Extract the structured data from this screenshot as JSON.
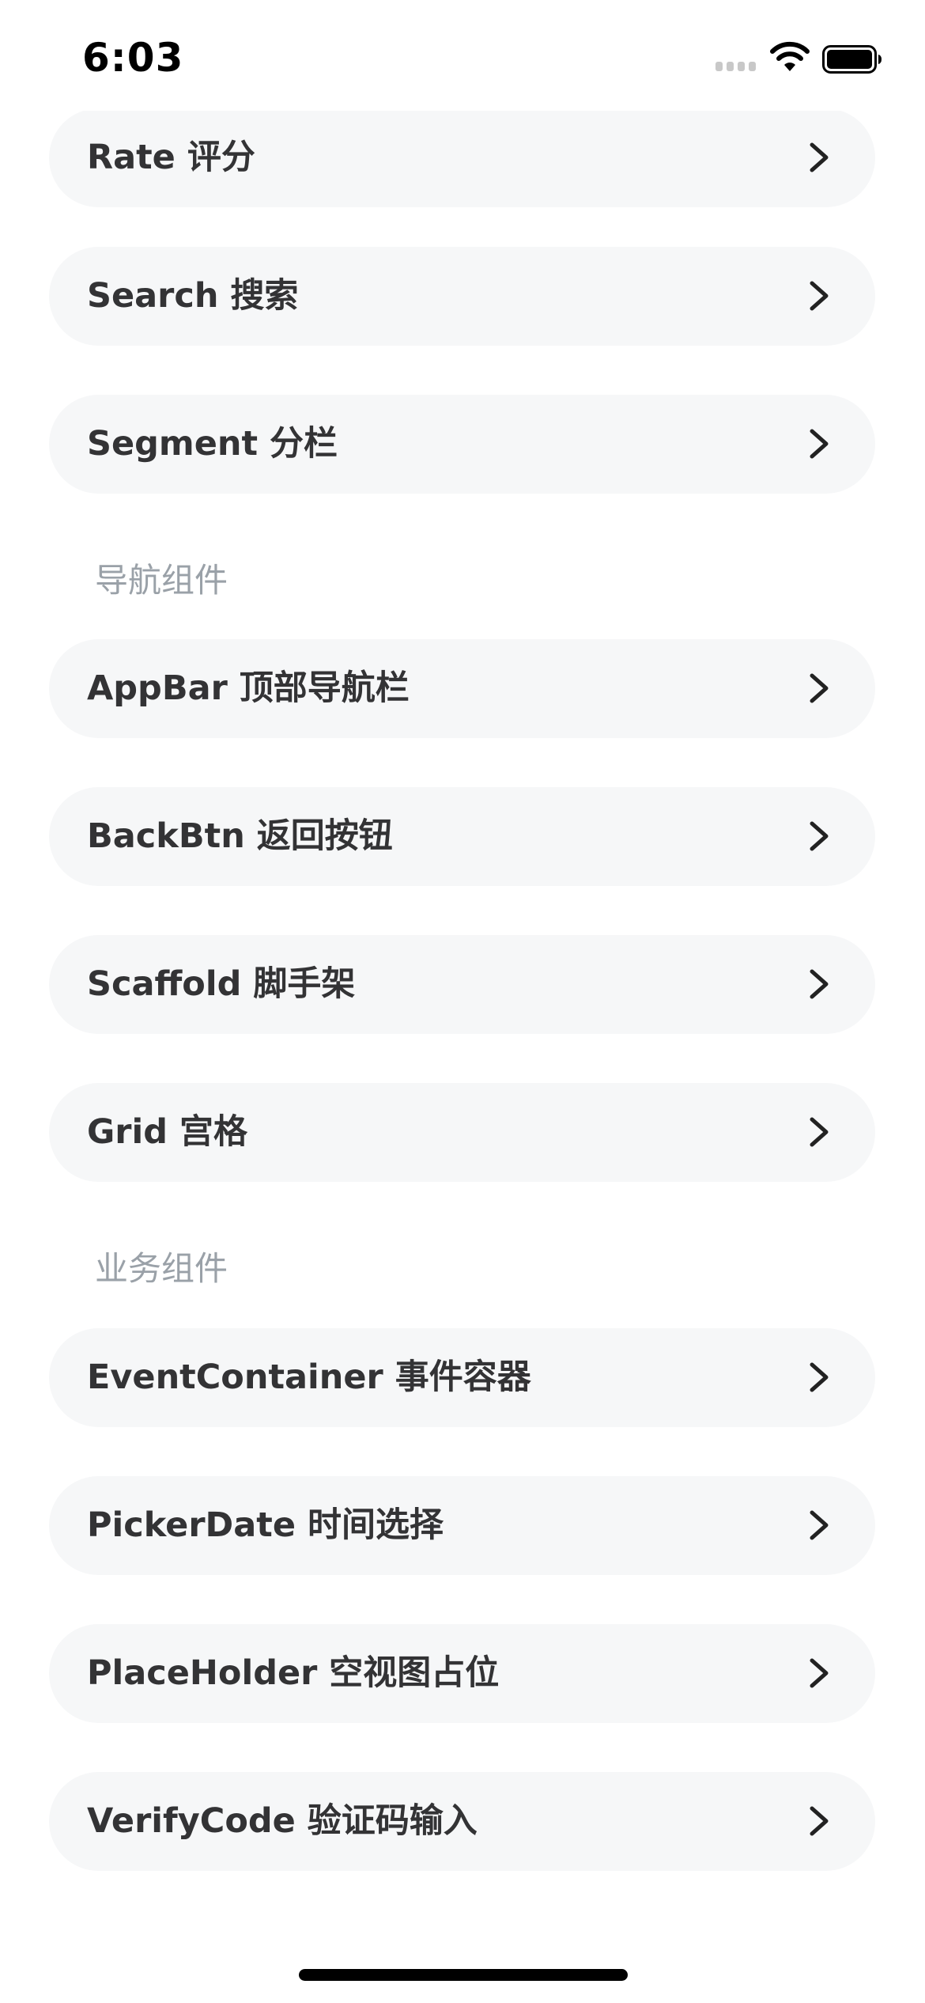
{
  "status_bar": {
    "time": "6:03"
  },
  "sections": [
    {
      "title": "",
      "items": [
        {
          "label": "Rate 评分"
        },
        {
          "label": "Search 搜索"
        },
        {
          "label": "Segment 分栏"
        }
      ]
    },
    {
      "title": "导航组件",
      "items": [
        {
          "label": "AppBar 顶部导航栏"
        },
        {
          "label": "BackBtn 返回按钮"
        },
        {
          "label": "Scaffold 脚手架"
        },
        {
          "label": "Grid 宫格"
        }
      ]
    },
    {
      "title": "业务组件",
      "items": [
        {
          "label": "EventContainer 事件容器"
        },
        {
          "label": "PickerDate 时间选择"
        },
        {
          "label": "PlaceHolder 空视图占位"
        },
        {
          "label": "VerifyCode 验证码输入"
        }
      ]
    }
  ],
  "icons": {
    "row_chevron": "chevron-right-icon",
    "signal": "cellular-signal-icon",
    "wifi": "wifi-icon",
    "battery": "battery-icon"
  },
  "colors": {
    "row_background": "#f6f7f8",
    "row_text": "#333335",
    "section_title": "#9aa1a8",
    "background": "#ffffff"
  }
}
